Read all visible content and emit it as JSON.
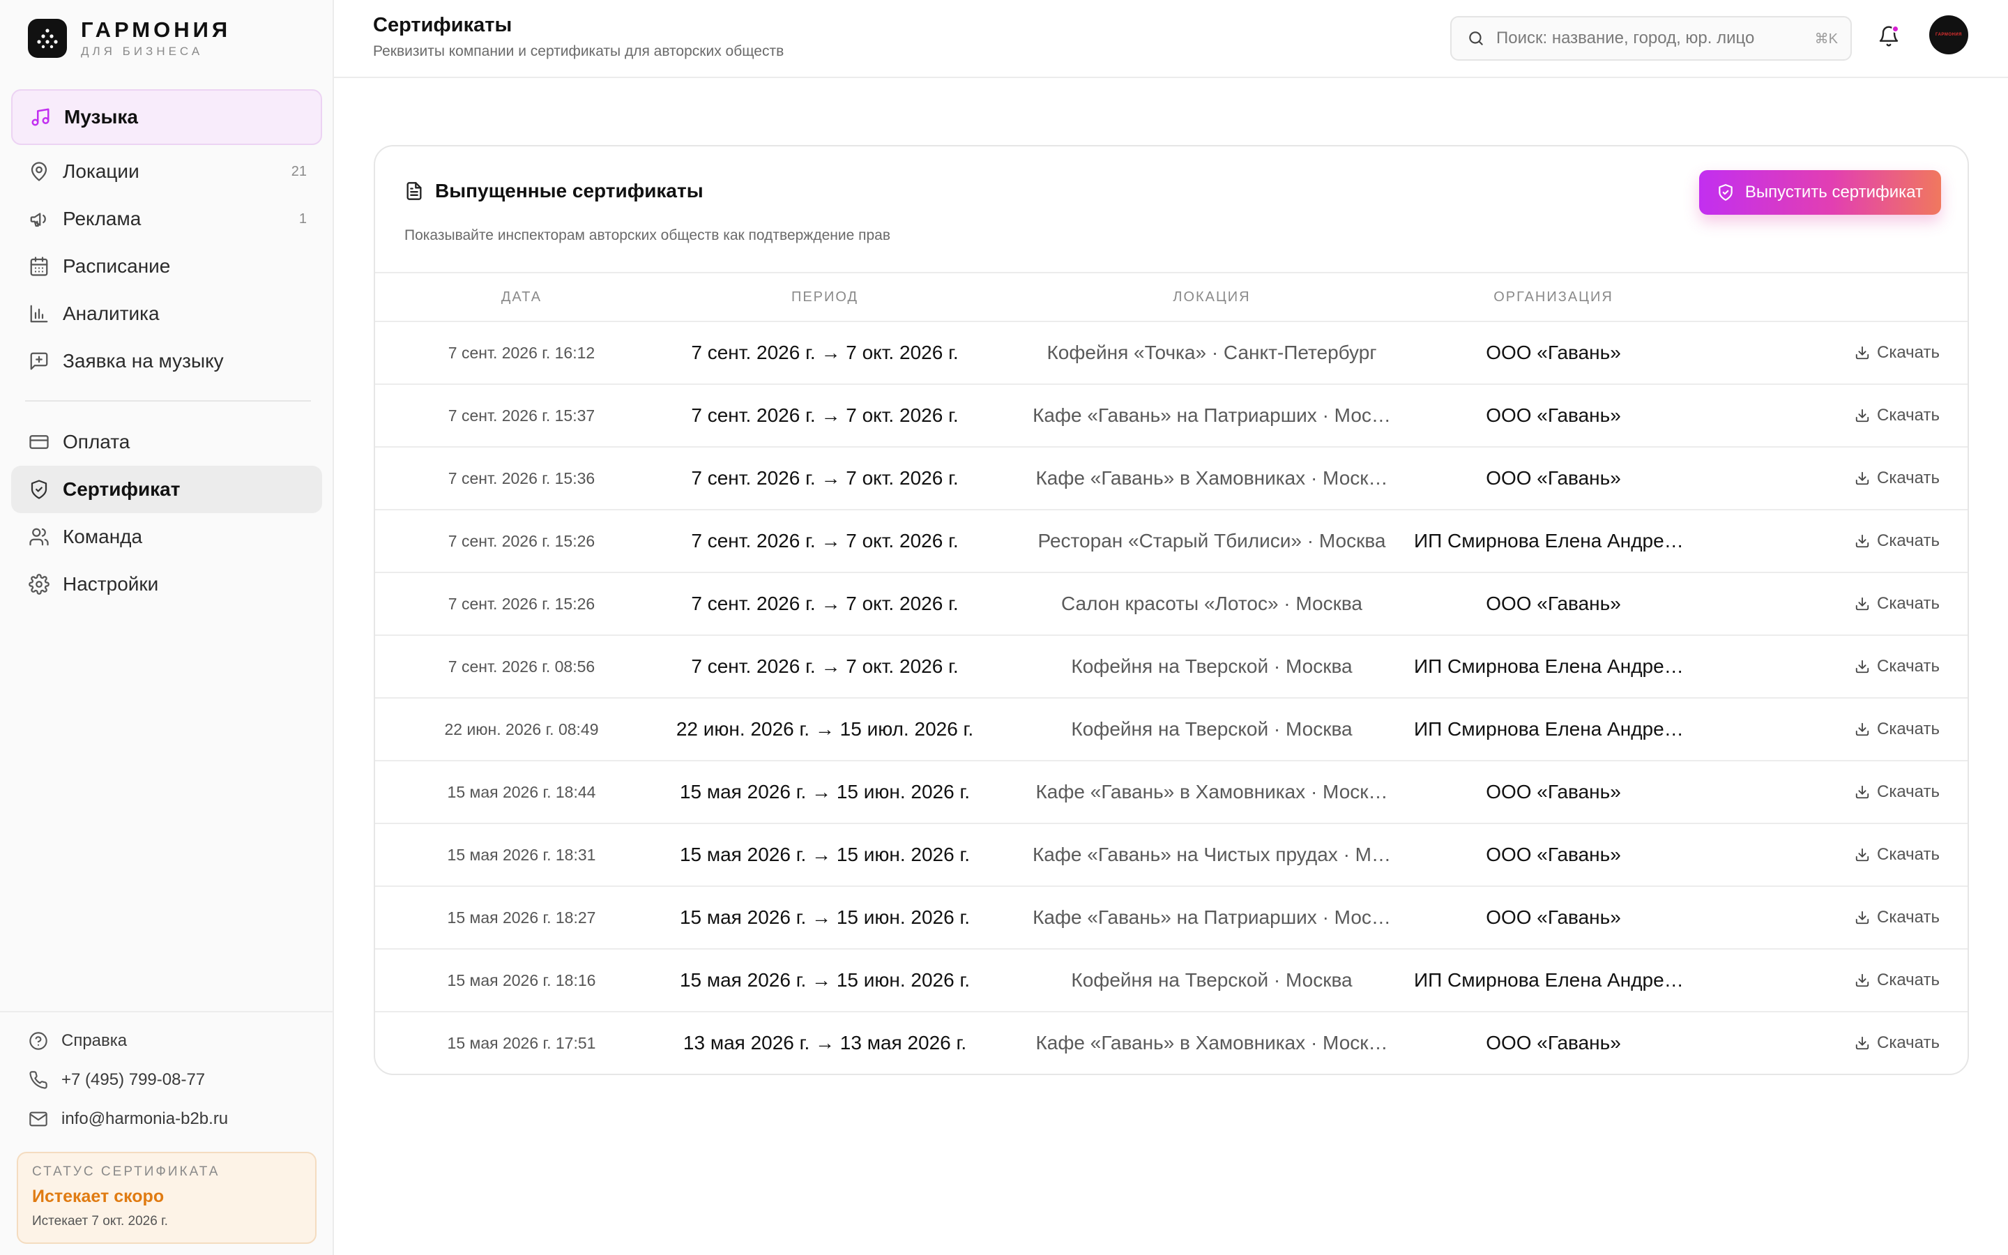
{
  "brand": {
    "name": "ГАРМОНИЯ",
    "subtitle": "ДЛЯ БИЗНЕСА"
  },
  "sidebar": {
    "items": [
      {
        "label": "Музыка",
        "icon": "music-note-icon",
        "badge": ""
      },
      {
        "label": "Локации",
        "icon": "map-pin-icon",
        "badge": "21"
      },
      {
        "label": "Реклама",
        "icon": "megaphone-icon",
        "badge": "1"
      },
      {
        "label": "Расписание",
        "icon": "calendar-icon",
        "badge": ""
      },
      {
        "label": "Аналитика",
        "icon": "bar-chart-icon",
        "badge": ""
      },
      {
        "label": "Заявка на музыку",
        "icon": "message-plus-icon",
        "badge": ""
      },
      {
        "label": "Оплата",
        "icon": "credit-card-icon",
        "badge": ""
      },
      {
        "label": "Сертификат",
        "icon": "shield-icon",
        "badge": ""
      },
      {
        "label": "Команда",
        "icon": "users-icon",
        "badge": ""
      },
      {
        "label": "Настройки",
        "icon": "gear-icon",
        "badge": ""
      }
    ],
    "active": "Сертификат",
    "help": {
      "label": "Справка",
      "icon": "help-circle-icon"
    },
    "phone": {
      "label": "+7 (495) 799-08-77",
      "icon": "phone-icon"
    },
    "email": {
      "label": "info@harmonia-b2b.ru",
      "icon": "mail-icon"
    },
    "status": {
      "title": "СТАТУС СЕРТИФИКАТА",
      "value": "Истекает скоро",
      "sub": "Истекает 7 окт. 2026 г.",
      "color": "#e07b12"
    }
  },
  "header": {
    "title": "Сертификаты",
    "subtitle": "Реквизиты компании и сертификаты для авторских обществ",
    "search_placeholder": "Поиск: название, город, юр. лицо",
    "shortcut": "⌘K",
    "avatar_text": "ГАРМОНИЯ"
  },
  "card": {
    "title": "Выпущенные сертификаты",
    "subtitle": "Показывайте инспекторам авторских обществ как подтверждение прав",
    "issue_button": "Выпустить сертификат",
    "columns": [
      "ДАТА",
      "ПЕРИОД",
      "ЛОКАЦИЯ",
      "ОРГАНИЗАЦИЯ"
    ],
    "download_label": "Скачать",
    "rows": [
      {
        "date": "7 сент. 2026 г. 16:12",
        "period": "7 сент. 2026 г. → 7 окт. 2026 г.",
        "location": "Кофейня «Точка» · Санкт-Петербург",
        "org": "ООО «Гавань»"
      },
      {
        "date": "7 сент. 2026 г. 15:37",
        "period": "7 сент. 2026 г. → 7 окт. 2026 г.",
        "location": "Кафе «Гавань» на Патриарших · Мос…",
        "org": "ООО «Гавань»"
      },
      {
        "date": "7 сент. 2026 г. 15:36",
        "period": "7 сент. 2026 г. → 7 окт. 2026 г.",
        "location": "Кафе «Гавань» в Хамовниках · Моск…",
        "org": "ООО «Гавань»"
      },
      {
        "date": "7 сент. 2026 г. 15:26",
        "period": "7 сент. 2026 г. → 7 окт. 2026 г.",
        "location": "Ресторан «Старый Тбилиси» · Москва",
        "org": "ИП Смирнова Елена Андреевна"
      },
      {
        "date": "7 сент. 2026 г. 15:26",
        "period": "7 сент. 2026 г. → 7 окт. 2026 г.",
        "location": "Салон красоты «Лотос» · Москва",
        "org": "ООО «Гавань»"
      },
      {
        "date": "7 сент. 2026 г. 08:56",
        "period": "7 сент. 2026 г. → 7 окт. 2026 г.",
        "location": "Кофейня на Тверской · Москва",
        "org": "ИП Смирнова Елена Андреевна"
      },
      {
        "date": "22 июн. 2026 г. 08:49",
        "period": "22 июн. 2026 г. → 15 июл. 2026 г.",
        "location": "Кофейня на Тверской · Москва",
        "org": "ИП Смирнова Елена Андреевна"
      },
      {
        "date": "15 мая 2026 г. 18:44",
        "period": "15 мая 2026 г. → 15 июн. 2026 г.",
        "location": "Кафе «Гавань» в Хамовниках · Моск…",
        "org": "ООО «Гавань»"
      },
      {
        "date": "15 мая 2026 г. 18:31",
        "period": "15 мая 2026 г. → 15 июн. 2026 г.",
        "location": "Кафе «Гавань» на Чистых прудах · М…",
        "org": "ООО «Гавань»"
      },
      {
        "date": "15 мая 2026 г. 18:27",
        "period": "15 мая 2026 г. → 15 июн. 2026 г.",
        "location": "Кафе «Гавань» на Патриарших · Мос…",
        "org": "ООО «Гавань»"
      },
      {
        "date": "15 мая 2026 г. 18:16",
        "period": "15 мая 2026 г. → 15 июн. 2026 г.",
        "location": "Кофейня на Тверской · Москва",
        "org": "ИП Смирнова Елена Андреевна"
      },
      {
        "date": "15 мая 2026 г. 17:51",
        "period": "13 мая 2026 г. → 13 мая 2026 г.",
        "location": "Кафе «Гавань» в Хамовниках · Моск…",
        "org": "ООО «Гавань»"
      }
    ]
  },
  "colors": {
    "accent_start": "#c22ff0",
    "accent_end": "#f0785e",
    "notification_dot": "#d61fd0",
    "status_warning": "#e07b12"
  }
}
